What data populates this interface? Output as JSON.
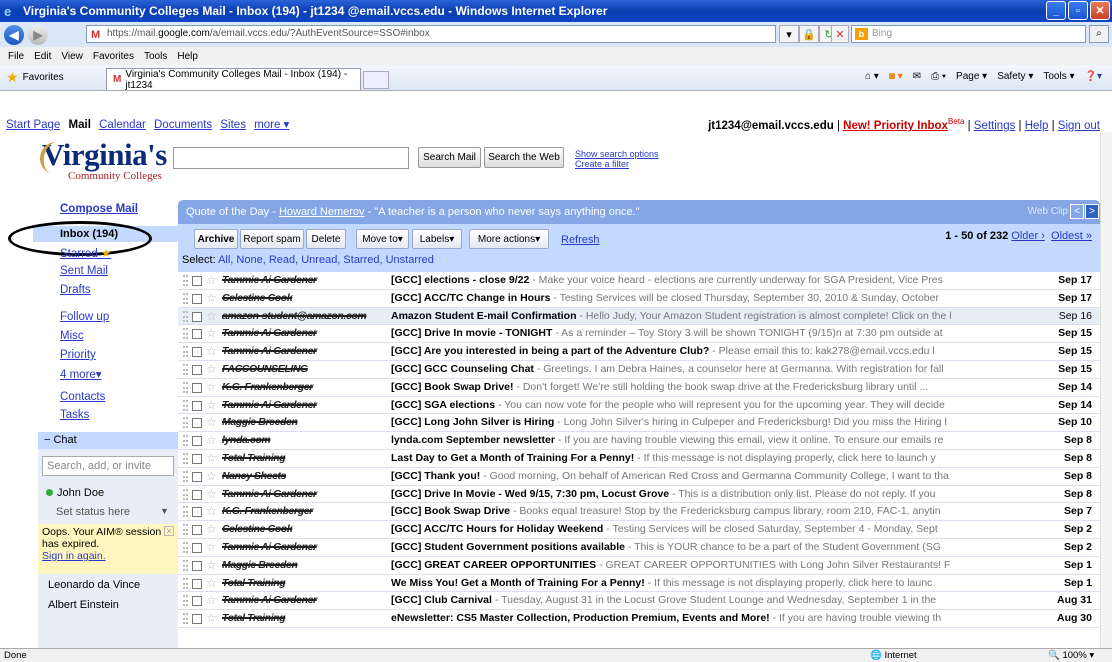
{
  "window": {
    "title": "Virginia's Community Colleges Mail - Inbox (194)  - jt1234 @email.vccs.edu - Windows Internet Explorer"
  },
  "browser": {
    "url_prefix": "https://mail.",
    "url_domain": "google.com",
    "url_rest": "/a/email.vccs.edu/?AuthEventSource=SSO#inbox",
    "search_placeholder": "Bing",
    "menu": [
      "File",
      "Edit",
      "View",
      "Favorites",
      "Tools",
      "Help"
    ],
    "favorites_label": "Favorites",
    "tab_title": "Virginia's Community Colleges Mail - Inbox (194) - jt1234",
    "commands": [
      "Page ▾",
      "Safety ▾",
      "Tools ▾"
    ],
    "status_left": "Done",
    "status_zone": "Internet",
    "status_zoom": "100%"
  },
  "topnav": {
    "links": [
      "Start Page",
      "Mail",
      "Calendar",
      "Documents",
      "Sites",
      "more ▾"
    ],
    "account": "jt1234@email.vccs.edu",
    "priority": "New! Priority Inbox",
    "beta": "Beta",
    "settings": "Settings",
    "help": "Help",
    "signout": "Sign out"
  },
  "logo": {
    "main": "Virginia's",
    "sub": "Community Colleges"
  },
  "search": {
    "mail_btn": "Search Mail",
    "web_btn": "Search the Web",
    "options": "Show search options",
    "filter": "Create a filter"
  },
  "nav": {
    "compose": "Compose Mail",
    "inbox": "Inbox (194)",
    "starred": "Starred",
    "sent": "Sent Mail",
    "drafts": "Drafts",
    "follow_up": "Follow up",
    "misc": "Misc",
    "priority": "Priority",
    "more": "4 more▾",
    "contacts": "Contacts",
    "tasks": "Tasks"
  },
  "chat": {
    "header": "Chat",
    "search_placeholder": "Search, add, or invite",
    "me": "John Doe",
    "status": "Set status here",
    "aim_msg": "Oops. Your AIM® session has expired.",
    "aim_link": "Sign in again.",
    "contacts": [
      "Leonardo da Vince",
      "Albert Einstein"
    ]
  },
  "quote": {
    "prefix": "Quote of the Day - ",
    "author": "Howard Nemerov",
    "text": " - \"A teacher is a person who never says anything once.\"",
    "webclip": "Web Clip"
  },
  "toolbar": {
    "archive": "Archive",
    "spam": "Report spam",
    "delete": "Delete",
    "moveto": "Move to▾",
    "labels": "Labels▾",
    "more": "More actions▾",
    "refresh": "Refresh",
    "range": "1 - 50 of 232",
    "older": "Older ›",
    "oldest": "Oldest »",
    "select_prefix": "Select: ",
    "select_options": "All, None, Read, Unread, Starred, Unstarred"
  },
  "messages": [
    {
      "sender": "Tammie Ai Gardener",
      "subject": "[GCC] elections - close 9/22",
      "snippet": " - Make your voice heard - elections are currently underway for SGA President, Vice Pres",
      "date": "Sep 17",
      "read": false
    },
    {
      "sender": "Celestine Cook",
      "subject": "[GCC] ACC/TC Change in Hours",
      "snippet": " - Testing Services will be closed Thursday, September 30, 2010 & Sunday, October",
      "date": "Sep 17",
      "read": false
    },
    {
      "sender": "amazon-student@amazon.com",
      "subject": "Amazon Student E-mail Confirmation",
      "snippet": " - Hello Judy, Your Amazon Student registration is almost complete! Click on the l",
      "date": "Sep 16",
      "read": true
    },
    {
      "sender": "Tammie Ai Gardener",
      "subject": "[GCC] Drive In movie - TONIGHT",
      "snippet": " - As a reminder – Toy Story 3 will be shown TONIGHT (9/15)n at 7:30 pm outside at",
      "date": "Sep 15",
      "read": false
    },
    {
      "sender": "Tammie Ai Gardener",
      "subject": "[GCC] Are you interested in being a part of the Adventure Club?",
      "snippet": " - Please email this to: kak278@email.vccs.edu l",
      "date": "Sep 15",
      "read": false
    },
    {
      "sender": "FACCOUNSELING",
      "subject": "[GCC] GCC Counseling Chat",
      "snippet": " - Greetings. I am Debra Haines, a counselor here at Germanna. With registration for fall",
      "date": "Sep 15",
      "read": false
    },
    {
      "sender": "K.G. Frankenberger",
      "subject": "[GCC] Book Swap Drive!",
      "snippet": " - Don't forget! We're still holding the book swap drive at the Fredericksburg library until ...",
      "date": "Sep 14",
      "read": false
    },
    {
      "sender": "Tammie Ai Gardener",
      "subject": "[GCC] SGA elections",
      "snippet": " - You can now vote for the people who will represent you for the upcoming year. They will decide",
      "date": "Sep 14",
      "read": false
    },
    {
      "sender": "Maggie Breeden",
      "subject": "[GCC] Long John Silver is Hiring",
      "snippet": " - Long John Silver's hiring in Culpeper and Fredericksburg! Did you miss the Hiring l",
      "date": "Sep 10",
      "read": false
    },
    {
      "sender": "lynda.com",
      "subject": "lynda.com September newsletter",
      "snippet": " - If you are having trouble viewing this email, view it online. To ensure our emails re",
      "date": "Sep 8",
      "read": false
    },
    {
      "sender": "Total Training",
      "subject": "Last Day to Get a Month of Training For a Penny!",
      "snippet": " - If this message is not displaying properly, click here to launch y",
      "date": "Sep 8",
      "read": false
    },
    {
      "sender": "Nancy Sheets",
      "subject": "[GCC] Thank you!",
      "snippet": " - Good morning, On behalf of American Red Cross and Germanna Community College, I want to tha",
      "date": "Sep 8",
      "read": false
    },
    {
      "sender": "Tammie Ai Gardener",
      "subject": "[GCC] Drive In Movie - Wed 9/15, 7:30 pm, Locust Grove",
      "snippet": " - This is a distribution only list. Please do not reply. If you",
      "date": "Sep 8",
      "read": false
    },
    {
      "sender": "K.G. Frankenberger",
      "subject": "[GCC] Book Swap Drive",
      "snippet": " - Books equal treasure! Stop by the Fredericksburg campus library, room 210, FAC-1, anytin",
      "date": "Sep 7",
      "read": false
    },
    {
      "sender": "Celestine Cook",
      "subject": "[GCC] ACC/TC Hours for Holiday Weekend",
      "snippet": " - Testing Services will be closed Saturday, September 4 - Monday, Sept",
      "date": "Sep 2",
      "read": false
    },
    {
      "sender": "Tammie Ai Gardener",
      "subject": "[GCC] Student Government positions available",
      "snippet": " - This is YOUR chance to be a part of the Student Government (SG",
      "date": "Sep 2",
      "read": false
    },
    {
      "sender": "Maggie Breeden",
      "subject": "[GCC] GREAT CAREER OPPORTUNITIES",
      "snippet": " - GREAT CAREER OPPORTUNITIES with Long John Silver Restaurants! F",
      "date": "Sep 1",
      "read": false
    },
    {
      "sender": "Total Training",
      "subject": "We Miss You! Get a Month of Training For a Penny!",
      "snippet": " - If this message is not displaying properly, click here to launc",
      "date": "Sep 1",
      "read": false
    },
    {
      "sender": "Tammie Ai Gardener",
      "subject": "[GCC] Club Carnival",
      "snippet": " - Tuesday, August 31 in the Locust Grove Student Lounge and Wednesday, September 1 in the",
      "date": "Aug 31",
      "read": false
    },
    {
      "sender": "Total Training",
      "subject": "eNewsletter: CS5 Master Collection, Production Premium, Events and More!",
      "snippet": " - If you are having trouble viewing th",
      "date": "Aug 30",
      "read": false
    }
  ]
}
